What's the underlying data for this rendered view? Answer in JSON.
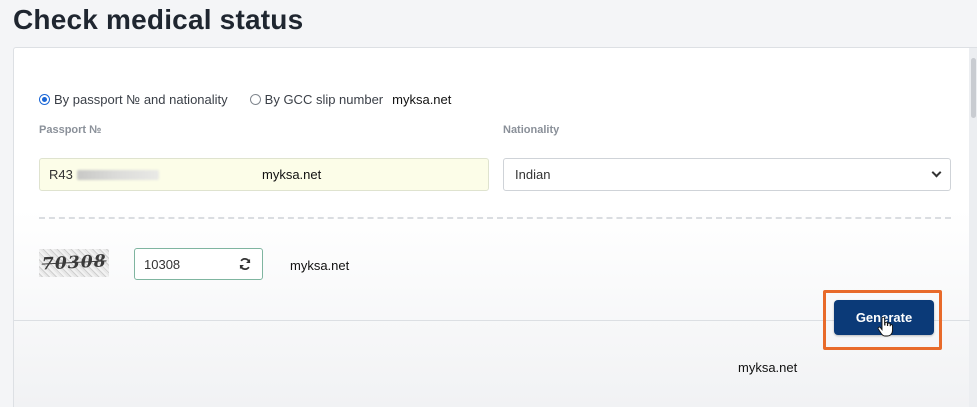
{
  "page": {
    "title": "Check medical status"
  },
  "search_mode": {
    "options": [
      {
        "label": "By passport № and nationality",
        "selected": true
      },
      {
        "label": "By GCC slip number",
        "selected": false
      }
    ]
  },
  "watermark": "myksa.net",
  "passport": {
    "label": "Passport №",
    "value": "R43"
  },
  "nationality": {
    "label": "Nationality",
    "value": "Indian"
  },
  "captcha": {
    "image_text": "70308",
    "value": "10308",
    "refresh_icon": "refresh-icon"
  },
  "actions": {
    "generate_label": "Generate"
  },
  "colors": {
    "primary": "#0b3a78",
    "highlight": "#e86a2a",
    "radio": "#1a66d6"
  }
}
